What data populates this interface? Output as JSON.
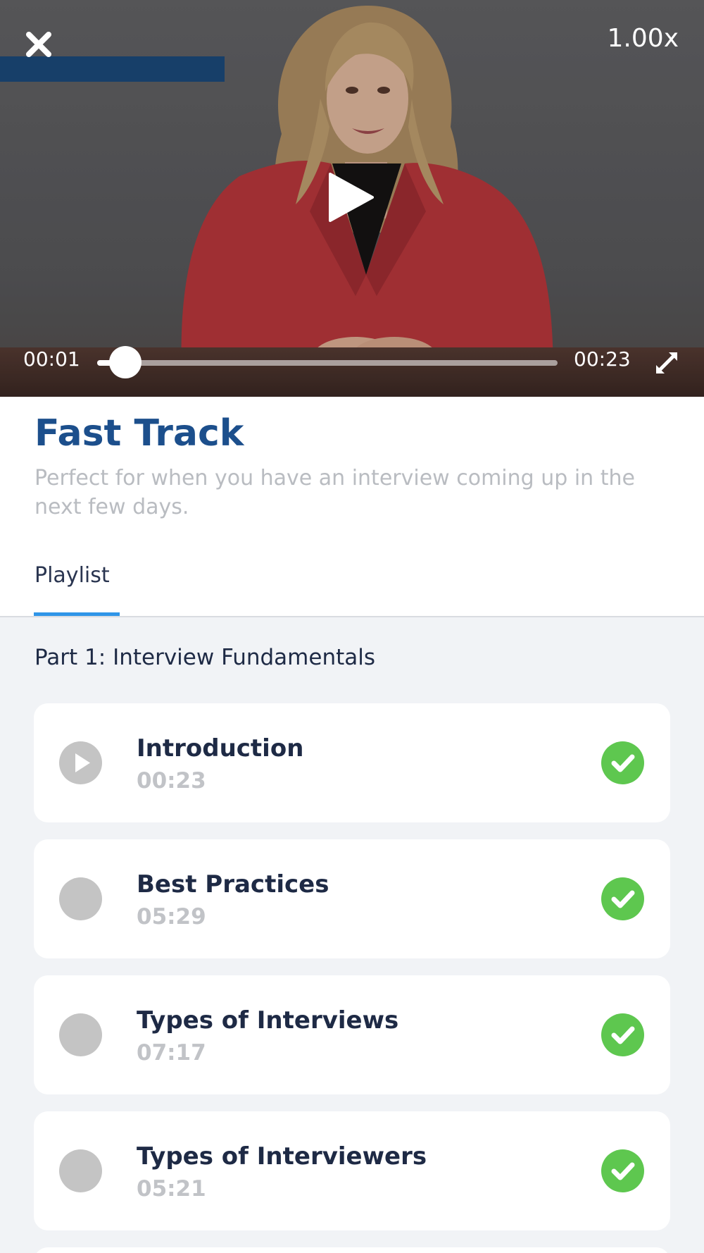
{
  "player": {
    "speed_label": "1.00x",
    "current_time": "00:01",
    "total_time": "00:23",
    "progress": 0.043
  },
  "course": {
    "title": "Fast Track",
    "description": "Perfect for when you have an interview coming up in the next few days."
  },
  "tabs": {
    "playlist_label": "Playlist"
  },
  "playlist": {
    "section_title": "Part 1: Interview Fundamentals",
    "items": [
      {
        "title": "Introduction",
        "duration": "00:23",
        "state": "playing",
        "completed": true
      },
      {
        "title": "Best Practices",
        "duration": "05:29",
        "state": "idle",
        "completed": true
      },
      {
        "title": "Types of Interviews",
        "duration": "07:17",
        "state": "idle",
        "completed": true
      },
      {
        "title": "Types of Interviewers",
        "duration": "05:21",
        "state": "idle",
        "completed": true
      }
    ]
  },
  "colors": {
    "title_blue": "#1c4f8c",
    "tab_accent": "#2f95e8",
    "playing_blue": "#1d64d8",
    "check_green": "#5ec74f"
  },
  "icons": {
    "close": "close-icon",
    "play": "play-icon",
    "fullscreen": "fullscreen-icon",
    "check": "check-icon"
  }
}
